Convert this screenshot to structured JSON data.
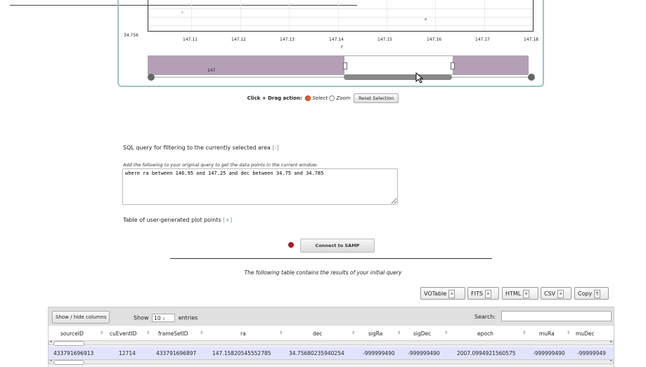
{
  "chart": {
    "y_min_label": "34.756",
    "x_ticks": [
      "147.11",
      "147.12",
      "147.13",
      "147.14",
      "147.15",
      "147.16",
      "147.17",
      "147.18"
    ],
    "x_label": "r",
    "navigator_label": "147",
    "points_color": "#7aa7d6"
  },
  "drag_action": {
    "label": "Click + Drag action:",
    "select_label": "Select",
    "zoom_label": "Zoom",
    "selected": "Select",
    "reset_label": "Reset Selection"
  },
  "sql": {
    "heading": "SQL query for filtering to the currently selected area",
    "toggle": "[-]",
    "hint": "Add the following to your original query to get the data points in the current window:",
    "query": "where ra between 146.95 and 147.25 and dec between 34.75 and 34.785"
  },
  "user_points": {
    "heading": "Table of user-generated plot points",
    "toggle": "[+]"
  },
  "samp": {
    "button_label": "Connect to SAMP",
    "status_color": "#b3141b"
  },
  "caption": "The following table contains the results of your initial query",
  "export_buttons": [
    "VOTable",
    "FITS",
    "HTML",
    "CSV",
    "Copy"
  ],
  "table": {
    "show_hide_label": "Show / hide columns",
    "show_label": "Show",
    "page_size": "10",
    "entries_label": "entries",
    "search_label": "Search:",
    "columns": [
      "sourceID",
      "cuEventID",
      "frameSetID",
      "ra",
      "dec",
      "sigRa",
      "sigDec",
      "epoch",
      "muRa",
      "muDec"
    ],
    "rows": [
      [
        "433791696913",
        "12714",
        "433791696897",
        "147.15820545552785",
        "34.75680235940254",
        "-999999490",
        "-999999490",
        "2007.0994921560575",
        "-999999490",
        "-99999949"
      ]
    ]
  }
}
